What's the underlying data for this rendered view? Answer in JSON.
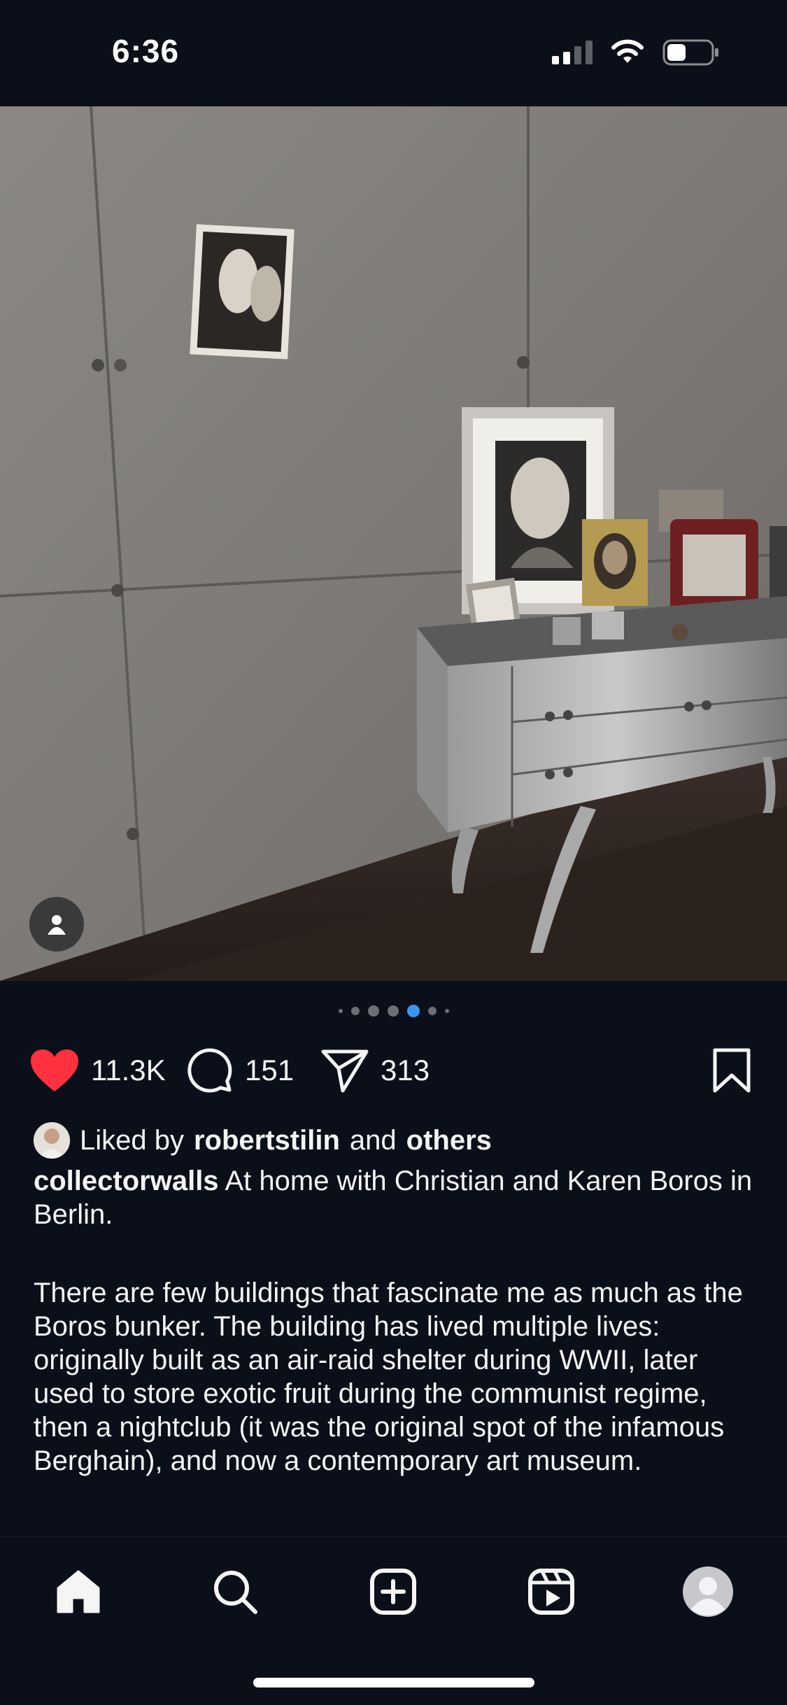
{
  "status_bar": {
    "time": "6:36",
    "signal_icon": "cellular-signal-icon",
    "wifi_icon": "wifi-icon",
    "battery_icon": "battery-icon"
  },
  "post": {
    "image_alt": "Concrete wall with framed artworks on a mirrored dresser",
    "tag_icon": "user-tag-icon",
    "carousel": {
      "count": 7,
      "active_index": 4
    },
    "actions": {
      "like_icon": "heart-filled-icon",
      "like_count": "11.3K",
      "comment_icon": "comment-icon",
      "comment_count": "151",
      "share_icon": "send-icon",
      "share_count": "313",
      "save_icon": "bookmark-icon"
    },
    "liked_by": {
      "prefix": "Liked by",
      "user": "robertstilin",
      "middle": "and",
      "others": "others"
    },
    "caption": {
      "username": "collectorwalls",
      "text": "At home with Christian and Karen Boros in Berlin."
    },
    "body": "There are few buildings that fascinate me as much as the Boros bunker. The building has lived multiple lives: originally built as an air-raid shelter during WWII, later used to store exotic fruit during the communist regime, then a nightclub (it was the original spot of the infamous Berghain), and now a contemporary art museum."
  },
  "nav": {
    "items": [
      "home-icon",
      "search-icon",
      "create-post-icon",
      "reels-icon",
      "profile-avatar"
    ]
  },
  "colors": {
    "background": "#0b0f19",
    "accent_blue": "#3897f0",
    "like_red": "#ff3040"
  }
}
